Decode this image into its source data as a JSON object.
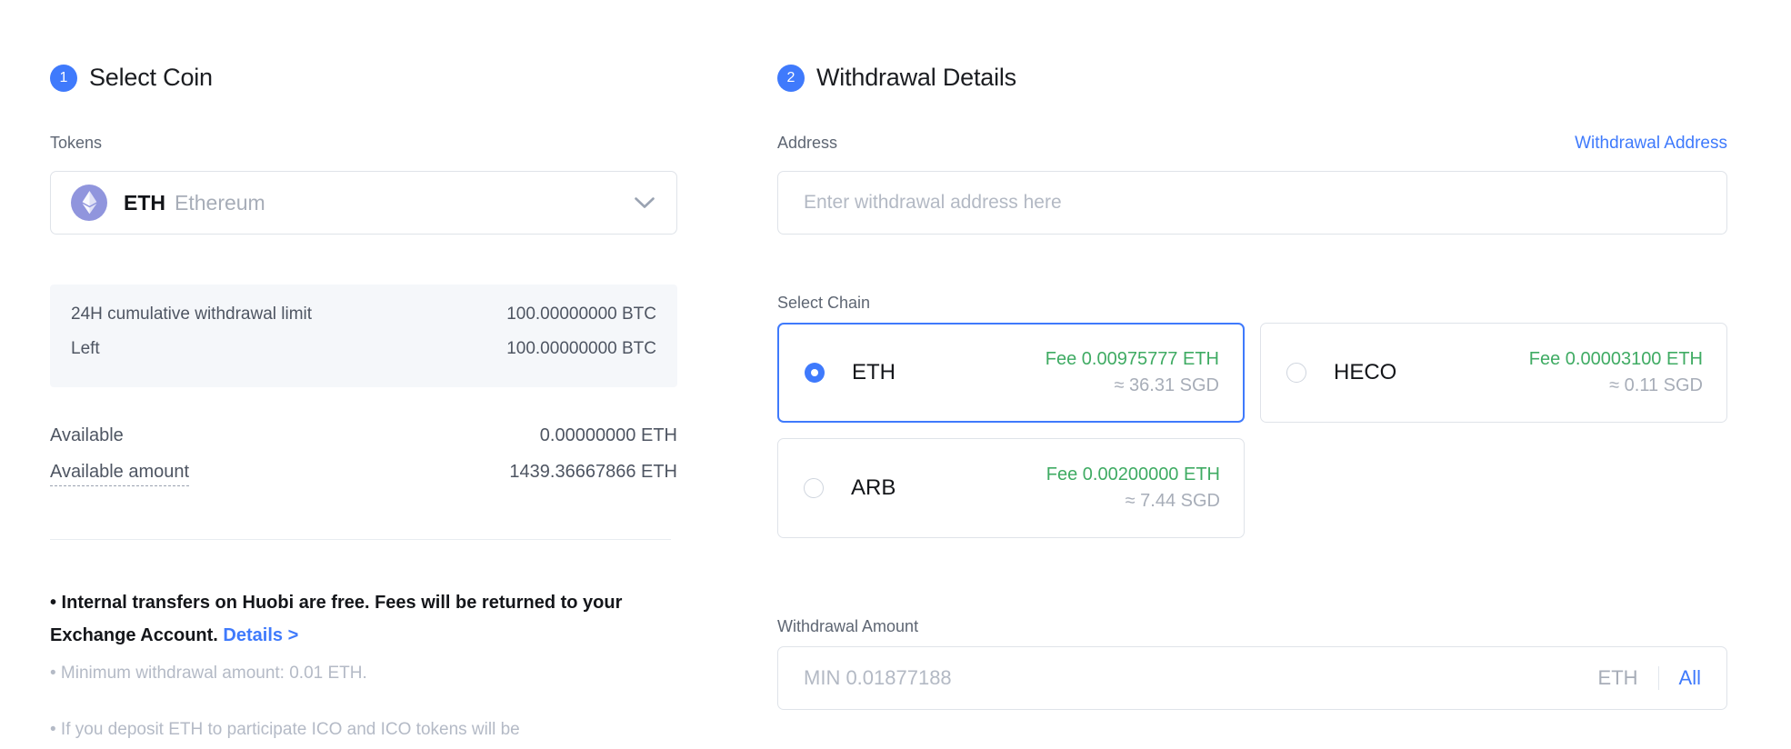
{
  "left": {
    "step": {
      "number": "1",
      "title": "Select Coin"
    },
    "tokens_label": "Tokens",
    "token": {
      "icon": "eth-coin-icon",
      "symbol": "ETH",
      "name": "Ethereum",
      "chevron": "chevron-down-icon"
    },
    "limits": [
      {
        "key": "24H cumulative withdrawal limit",
        "value": "100.00000000 BTC"
      },
      {
        "key": "Left",
        "value": "100.00000000 BTC"
      }
    ],
    "balances": [
      {
        "key": "Available",
        "value": "0.00000000 ETH"
      },
      {
        "key": "Available amount",
        "value": "1439.36667866 ETH"
      }
    ],
    "notes": {
      "primary": "• Internal transfers on Huobi are free. Fees will be returned to your Exchange Account.",
      "primary_link": "Details >",
      "minimum": "• Minimum withdrawal amount: 0.01 ETH.",
      "ico": "• If you deposit ETH to participate ICO and ICO tokens will be"
    }
  },
  "right": {
    "step": {
      "number": "2",
      "title": "Withdrawal Details"
    },
    "address": {
      "label": "Address",
      "link": "Withdrawal Address",
      "value": "",
      "placeholder": "Enter withdrawal address here"
    },
    "chain": {
      "label": "Select Chain",
      "options": [
        {
          "name": "ETH",
          "fee": "Fee 0.00975777 ETH",
          "fiat": "≈ 36.31 SGD",
          "selected": true
        },
        {
          "name": "HECO",
          "fee": "Fee 0.00003100 ETH",
          "fiat": "≈ 0.11 SGD",
          "selected": false
        },
        {
          "name": "ARB",
          "fee": "Fee 0.00200000 ETH",
          "fiat": "≈ 7.44 SGD",
          "selected": false
        }
      ]
    },
    "amount": {
      "label": "Withdrawal Amount",
      "value": "",
      "placeholder": "MIN 0.01877188",
      "unit": "ETH",
      "all_label": "All"
    }
  },
  "colors": {
    "accent": "#3f7afc",
    "fee_green": "#3fab63",
    "muted": "#a7adb8",
    "panel_bg": "#f5f7fa",
    "border": "#dfe3e9"
  }
}
